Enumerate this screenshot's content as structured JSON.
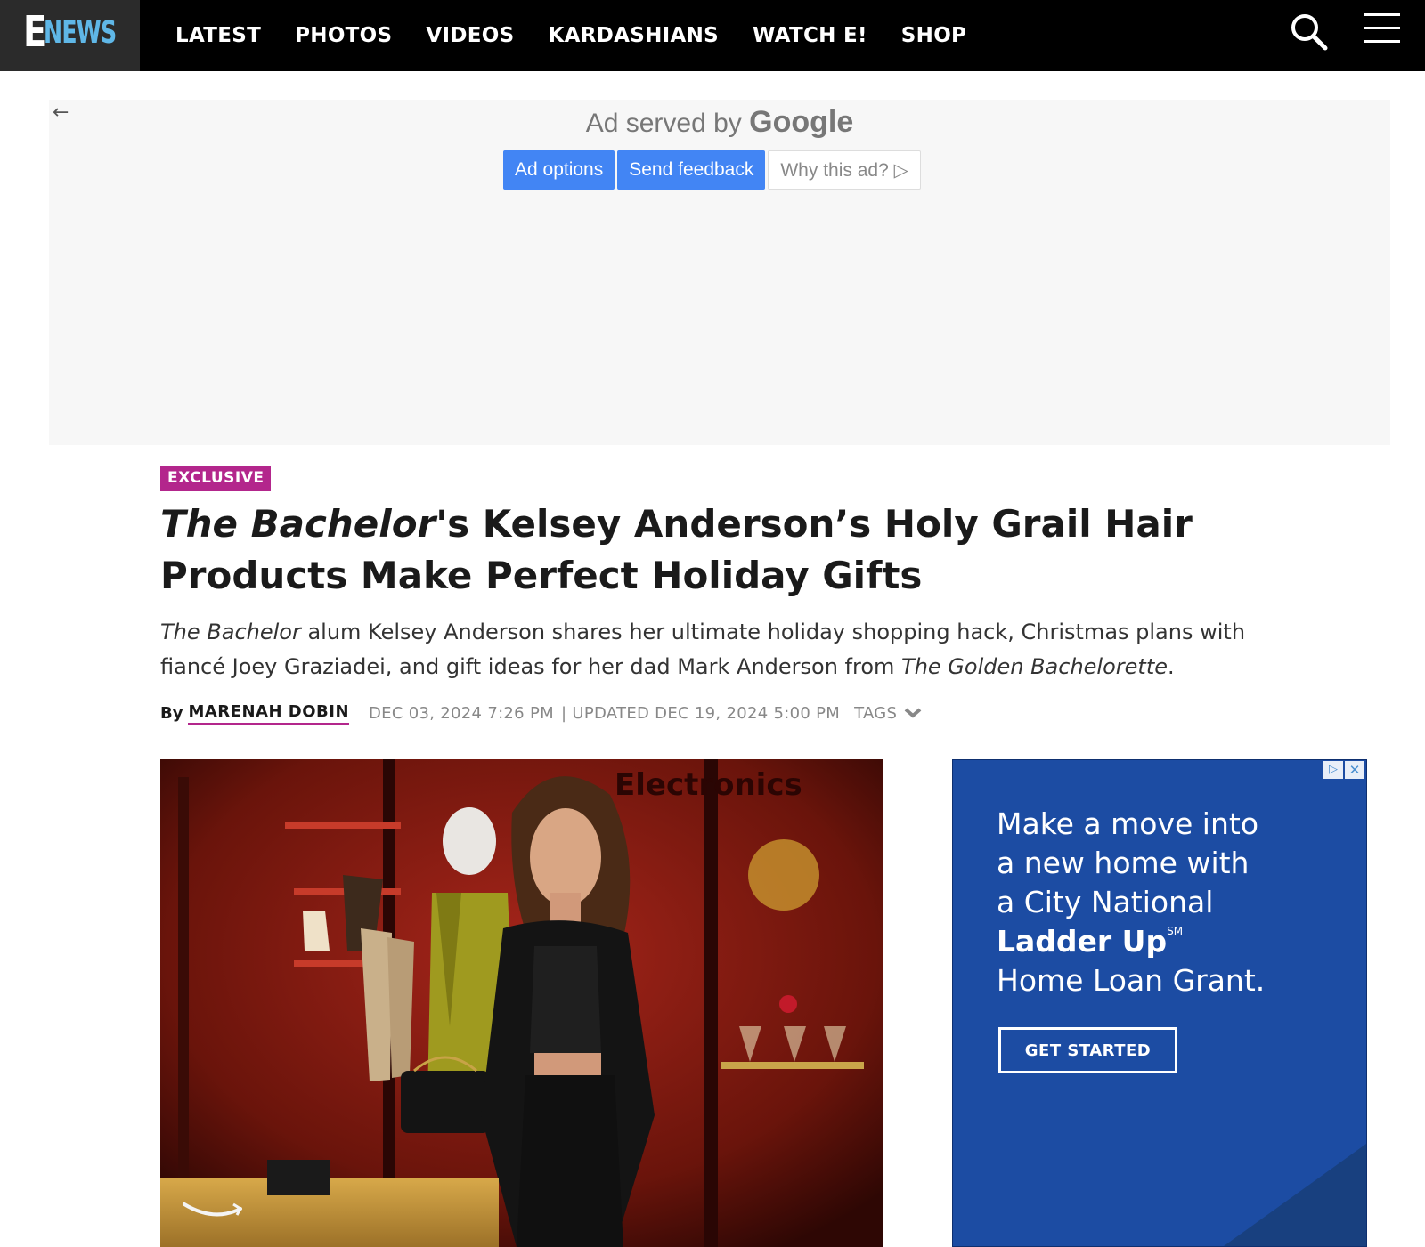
{
  "brand": {
    "logo_e": "E",
    "logo_news": "NEWS"
  },
  "nav": {
    "links": [
      "LATEST",
      "PHOTOS",
      "VIDEOS",
      "KARDASHIANS",
      "WATCH E!",
      "SHOP"
    ],
    "search_icon": "search-icon",
    "menu_icon": "hamburger-menu-icon"
  },
  "ad_banner": {
    "served_prefix": "Ad served by",
    "served_brand": "Google",
    "back_arrow": "←",
    "buttons": {
      "ad_options": "Ad options",
      "send_feedback": "Send feedback",
      "why_this_ad": "Why this ad? ▷"
    }
  },
  "article": {
    "badge": "EXCLUSIVE",
    "headline_italic": "The Bachelor",
    "headline_rest": "'s Kelsey Anderson’s Holy Grail Hair Products Make Perfect Holiday Gifts",
    "dek_italic_1": "The Bachelor",
    "dek_part_1": " alum Kelsey Anderson shares her ultimate holiday shopping hack, Christmas plans with fiancé Joey Graziadei, and gift ideas for her dad Mark Anderson from ",
    "dek_italic_2": "The Golden Bachelorette",
    "dek_part_2": ".",
    "byline_label": "By",
    "author": "MARENAH DOBIN",
    "published": "DEC 03, 2024 7:26 PM",
    "updated": "| UPDATED DEC 19, 2024 5:00 PM",
    "tags_label": "TAGS"
  },
  "hero_image": {
    "sign_text": "Electronics"
  },
  "side_ad": {
    "line1": "Make a move into",
    "line2": "a new home with",
    "line3": "a City National",
    "line4": "Ladder Up",
    "sup": "SM",
    "line5": "Home Loan Grant.",
    "cta": "GET STARTED",
    "choice_icon": "▷",
    "close_icon": "✕"
  },
  "colors": {
    "nav_bg": "#000000",
    "logo_blue": "#5fb7e7",
    "badge_magenta": "#b3268c",
    "google_blue": "#4285f4",
    "side_ad_blue": "#1c4ca3"
  }
}
